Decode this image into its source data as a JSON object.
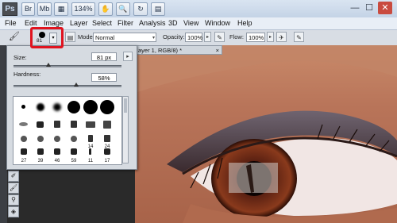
{
  "titlebar": {
    "logo": "Ps",
    "buttons": [
      "Br",
      "Mb",
      "",
      "134%",
      "",
      ""
    ],
    "zoom": "134%"
  },
  "menu": [
    "File",
    "Edit",
    "Image",
    "Layer",
    "Select",
    "Filter",
    "Analysis",
    "3D",
    "View",
    "Window",
    "Help"
  ],
  "options": {
    "brush_size": "81",
    "mode_label": "Mode:",
    "mode_value": "Normal",
    "opacity_label": "Opacity:",
    "opacity_value": "100%",
    "flow_label": "Flow:",
    "flow_value": "100%"
  },
  "document": {
    "tab_title": "ayer 1, RGB/8) *",
    "close": "×"
  },
  "brush_panel": {
    "size_label": "Size:",
    "size_value": "81 px",
    "size_fraction": 0.32,
    "hardness_label": "Hardness:",
    "hardness_value": "58%",
    "hardness_fraction": 0.58,
    "preset_numbers": [
      "27",
      "39",
      "46",
      "59",
      "11",
      "17"
    ],
    "row3_numbers": [
      "",
      "",
      "",
      "",
      "14",
      "24"
    ]
  },
  "colors": {
    "highlight": "#e0141f",
    "panel_bg": "#d6dbe1"
  }
}
